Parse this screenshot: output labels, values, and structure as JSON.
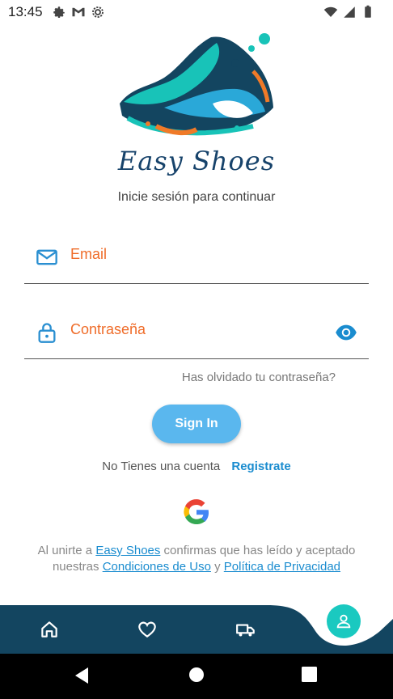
{
  "status": {
    "time": "13:45"
  },
  "brand": {
    "name": "Easy Shoes",
    "subtitle": "Inicie sesión para continuar"
  },
  "form": {
    "email_placeholder": "Email",
    "password_placeholder": "Contraseña",
    "forgot": "Has olvidado tu contraseña?",
    "signin": "Sign In",
    "no_account": "No Tienes una cuenta",
    "register": "Registrate"
  },
  "legal": {
    "part1": "Al unirte a",
    "brand_link": "Easy Shoes",
    "part2": "confirmas que has leído y aceptado nuestras",
    "terms": "Condiciones de Uso",
    "and": "y",
    "privacy": "Política de Privacidad"
  },
  "icons": {
    "email": "mail-icon",
    "password": "lock-icon",
    "visibility": "eye-icon",
    "google": "google-icon",
    "nav": [
      "home-icon",
      "heart-icon",
      "truck-icon",
      "person-icon"
    ]
  },
  "colors": {
    "accent": "#ef6c29",
    "link": "#1a8ccf",
    "button": "#5ab7ee",
    "nav_bg": "#134560",
    "fab": "#1ac9c0"
  }
}
